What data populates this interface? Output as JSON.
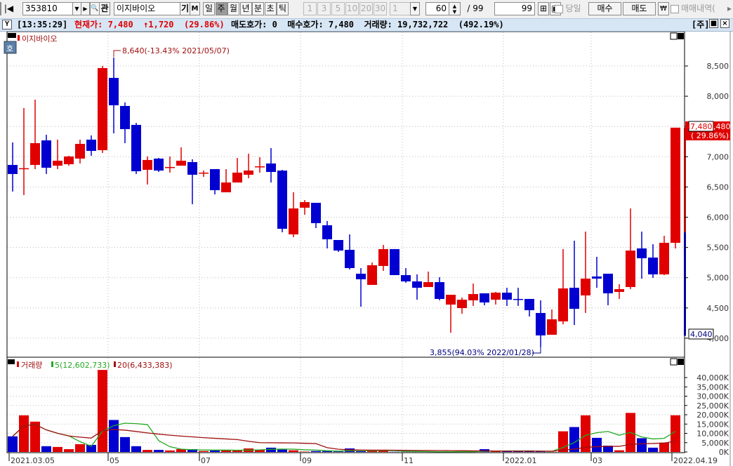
{
  "toolbar": {
    "first_icon": "|◀",
    "code": "353810",
    "dropdown_icon": "▼",
    "next_icon": "▶",
    "search_icon": "🔍",
    "interest_label": "관",
    "name": "이지바이오",
    "gi_label": "기",
    "m_label": "M",
    "periods": [
      {
        "label": "일",
        "active": false
      },
      {
        "label": "주",
        "active": true
      },
      {
        "label": "월",
        "active": false
      },
      {
        "label": "년",
        "active": false
      },
      {
        "label": "분",
        "active": false
      },
      {
        "label": "초",
        "active": false
      },
      {
        "label": "틱",
        "active": false
      }
    ],
    "intervals": [
      "1",
      "3",
      "5",
      "10",
      "20",
      "30"
    ],
    "interval_select": "1",
    "count": "60",
    "count_max": "/ 99",
    "count2": "99",
    "today_label": "당일",
    "buy_label": "매수",
    "sell_label": "매도",
    "won_label": "₩",
    "trade_history_label": "매매내역(",
    "more_icon": "▸"
  },
  "info": {
    "time": "[13:35:29]",
    "current": "현재가: 7,480  ↑1,720  (29.86%)",
    "rest": "매도호가: 0  매수호가: 7,480  거래량: 19,732,722  (492.19%)",
    "period": "[주]",
    "max_icon": "■",
    "close_icon": "×"
  },
  "price_panel": {
    "badge": "호",
    "title": "이지바이오",
    "high_note": "8,640(-13.43% 2021/05/07)",
    "low_note": "3,855(94.03% 2022/01/28)",
    "last_price": "7,480",
    "last_tail": ",480",
    "last_change": "( 29.86%)",
    "low_marker": "4,040",
    "axis": [
      "8,500",
      "8,000",
      "7,500",
      "7,000",
      "6,500",
      "6,000",
      "5,500",
      "5,000",
      "4,500",
      "4,000"
    ]
  },
  "volume_panel": {
    "title": "거래량",
    "ma5": "5(12,602,733)",
    "ma20": "20(6,433,383)",
    "axis": [
      "40,000K",
      "35,000K",
      "30,000K",
      "25,000K",
      "20,000K",
      "15,000K",
      "10,000K",
      "5,000K",
      "0K"
    ]
  },
  "x_labels": [
    "2021.03.05",
    "05",
    "07",
    "09",
    "11",
    "2022.01",
    "03",
    "2022.04.19"
  ],
  "colors": {
    "up": "#e00000",
    "down": "#0000d0",
    "ma5": "#22aa22",
    "ma20": "#a01010"
  },
  "chart_data": {
    "type": "candlestick",
    "period": "weekly",
    "ylim": [
      3800,
      8800
    ],
    "vol_ylim": [
      0,
      45000
    ],
    "ohlc": [
      [
        6864,
        7236,
        6424,
        6714
      ],
      [
        6806,
        7804,
        6366,
        6810
      ],
      [
        6864,
        7943,
        6795,
        7224
      ],
      [
        7270,
        7363,
        6714,
        6818
      ],
      [
        6852,
        7282,
        6795,
        6934
      ],
      [
        6876,
        7015,
        6852,
        7004
      ],
      [
        6969,
        7282,
        6888,
        7212
      ],
      [
        7282,
        7352,
        7015,
        7096
      ],
      [
        7108,
        8500,
        7062,
        8465
      ],
      [
        8303,
        8640,
        7386,
        7850
      ],
      [
        7839,
        7897,
        7224,
        7456
      ],
      [
        7526,
        7560,
        6714,
        6760
      ],
      [
        6783,
        7004,
        6540,
        6946
      ],
      [
        6969,
        6980,
        6748,
        6771
      ],
      [
        6818,
        7004,
        6737,
        6830
      ],
      [
        6852,
        7154,
        6852,
        6934
      ],
      [
        6911,
        6957,
        6215,
        6702
      ],
      [
        6725,
        6772,
        6667,
        6737
      ],
      [
        6795,
        6795,
        6377,
        6447
      ],
      [
        6412,
        6795,
        6412,
        6574
      ],
      [
        6574,
        6980,
        6574,
        6737
      ],
      [
        6702,
        7050,
        6644,
        6772
      ],
      [
        6830,
        6992,
        6737,
        6841
      ],
      [
        6888,
        7143,
        6574,
        6748
      ],
      [
        6771,
        6783,
        5751,
        5809
      ],
      [
        5716,
        6412,
        5670,
        6145
      ],
      [
        6157,
        6284,
        6041,
        6250
      ],
      [
        6238,
        6238,
        5820,
        5902
      ],
      [
        5867,
        5937,
        5484,
        5635
      ],
      [
        5623,
        5623,
        5426,
        5449
      ],
      [
        5461,
        5716,
        5136,
        5159
      ],
      [
        5066,
        5159,
        4521,
        4974
      ],
      [
        4881,
        5252,
        4881,
        5206
      ],
      [
        5194,
        5542,
        5113,
        5473
      ],
      [
        5473,
        5473,
        5043,
        5043
      ],
      [
        5043,
        5159,
        4916,
        4939
      ],
      [
        4939,
        5055,
        4637,
        4834
      ],
      [
        4846,
        5101,
        4846,
        4927
      ],
      [
        4927,
        5008,
        4626,
        4649
      ],
      [
        4556,
        4602,
        4092,
        4718
      ],
      [
        4498,
        4672,
        4405,
        4637
      ],
      [
        4626,
        4904,
        4533,
        4730
      ],
      [
        4742,
        4742,
        4544,
        4591
      ],
      [
        4637,
        4765,
        4556,
        4753
      ],
      [
        4753,
        4834,
        4533,
        4637
      ],
      [
        4649,
        4834,
        4533,
        4637
      ],
      [
        4649,
        4649,
        4359,
        4463
      ],
      [
        4417,
        4626,
        3855,
        4046
      ],
      [
        4057,
        4475,
        4057,
        4312
      ],
      [
        4278,
        5473,
        4231,
        4823
      ],
      [
        4834,
        5612,
        4219,
        4486
      ],
      [
        4707,
        5762,
        4417,
        4985
      ],
      [
        5020,
        5345,
        4834,
        4985
      ],
      [
        5066,
        5066,
        4544,
        4742
      ],
      [
        4765,
        4892,
        4649,
        4811
      ],
      [
        4846,
        6145,
        4811,
        5449
      ],
      [
        5484,
        5762,
        4985,
        5322
      ],
      [
        5333,
        5554,
        4997,
        5055
      ],
      [
        5055,
        5693,
        5043,
        5577
      ],
      [
        5577,
        7480,
        5484,
        7480
      ]
    ],
    "volume_k": [
      8400,
      19700,
      16300,
      3100,
      2700,
      1500,
      4200,
      3800,
      44100,
      17200,
      8000,
      3100,
      1100,
      1100,
      800,
      1500,
      1500,
      500,
      800,
      800,
      1100,
      1900,
      1100,
      2300,
      1300,
      900,
      200,
      500,
      500,
      300,
      1900,
      400,
      600,
      600,
      100,
      100,
      100,
      100,
      100,
      100,
      400,
      100,
      1500,
      400,
      400,
      400,
      400,
      400,
      100,
      11100,
      13400,
      19700,
      7600,
      3400,
      900,
      21000,
      7400,
      2300,
      5000,
      19733
    ]
  }
}
